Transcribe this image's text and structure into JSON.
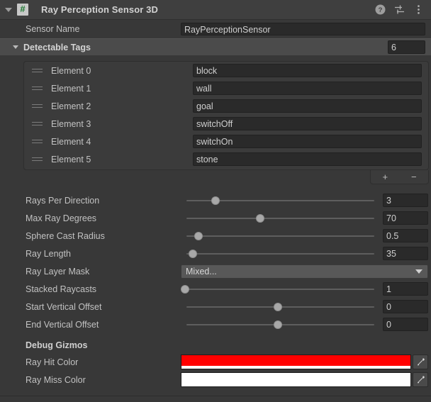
{
  "header": {
    "title": "Ray Perception Sensor 3D",
    "foldout_icon": "triangle-down-icon",
    "script_icon": "cs-script-icon",
    "icons": [
      {
        "name": "help-icon",
        "label": "?"
      },
      {
        "name": "preset-icon",
        "label": ""
      },
      {
        "name": "kebab-menu-icon",
        "label": "⋮"
      }
    ]
  },
  "sensor_name": {
    "label": "Sensor Name",
    "value": "RayPerceptionSensor"
  },
  "detectable_tags": {
    "label": "Detectable Tags",
    "count": "6",
    "elements": [
      {
        "label": "Element 0",
        "value": "block"
      },
      {
        "label": "Element 1",
        "value": "wall"
      },
      {
        "label": "Element 2",
        "value": "goal"
      },
      {
        "label": "Element 3",
        "value": "switchOff"
      },
      {
        "label": "Element 4",
        "value": "switchOn"
      },
      {
        "label": "Element 5",
        "value": "stone"
      }
    ],
    "footer": {
      "add_label": "+",
      "remove_label": "−"
    }
  },
  "sliders": [
    {
      "label": "Rays Per Direction",
      "value": "3",
      "percent": 9
    },
    {
      "label": "Max Ray Degrees",
      "value": "70",
      "percent": 39
    },
    {
      "label": "Sphere Cast Radius",
      "value": "0.5",
      "percent": 8
    },
    {
      "label": "Ray Length",
      "value": "35",
      "percent": 6
    }
  ],
  "layer_mask": {
    "label": "Ray Layer Mask",
    "value": "Mixed..."
  },
  "sliders2": [
    {
      "label": "Stacked Raycasts",
      "value": "1",
      "percent": 0
    },
    {
      "label": "Start Vertical Offset",
      "value": "0",
      "percent": 50
    },
    {
      "label": "End Vertical Offset",
      "value": "0",
      "percent": 50
    }
  ],
  "debug_gizmos": {
    "heading": "Debug Gizmos",
    "colors": [
      {
        "label": "Ray Hit Color",
        "color": "#ff0000",
        "alpha_color": "#ffffff"
      },
      {
        "label": "Ray Miss Color",
        "color": "#ffffff",
        "alpha_color": "#ffffff"
      }
    ]
  },
  "theme": {
    "background": "#383838",
    "header_bg": "#3f3f3f",
    "field_bg": "#2a2a2a",
    "accent_green": "#1f7a33"
  }
}
